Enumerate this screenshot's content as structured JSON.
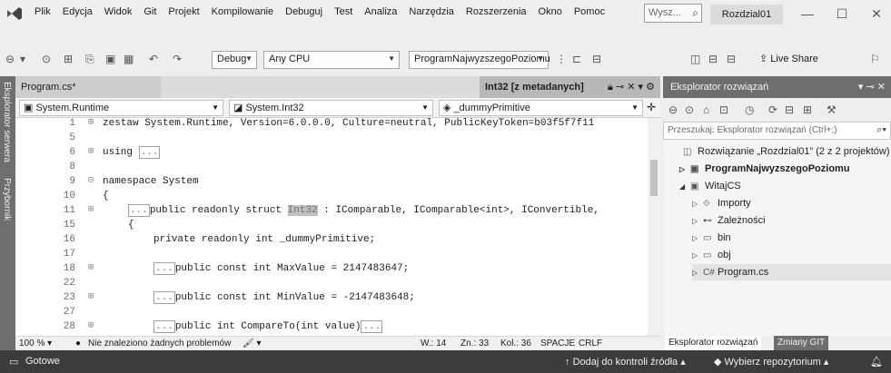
{
  "menu": {
    "items": [
      "Plik",
      "Edycja",
      "Widok",
      "Git",
      "Projekt",
      "Kompilowanie",
      "Debuguj",
      "Test",
      "Analiza",
      "Narzędzia",
      "Rozszerzenia",
      "Okno",
      "Pomoc"
    ],
    "search_label": "Wysz...",
    "project_name": "Rozdzial01"
  },
  "toolbar": {
    "config": "Debug",
    "platform": "Any CPU",
    "startup_project": "ProgramNajwyzszegoPoziomu",
    "live_share": "Live Share"
  },
  "side_tabs": [
    "Eksplorator serwera",
    "Przybornik"
  ],
  "editor": {
    "tabs": [
      "Program.cs*",
      "Int32 [z metadanych]"
    ],
    "nav": {
      "assembly": "System.Runtime",
      "type": "System.Int32",
      "member": "_dummyPrimitive"
    },
    "lines": [
      {
        "num": "1",
        "fold": "⊞",
        "text": "zestaw System.Runtime, Version=6.0.0.0, Culture=neutral, PublicKeyToken=b03f5f7f11"
      },
      {
        "num": "5",
        "fold": "",
        "text": ""
      },
      {
        "num": "6",
        "fold": "⊞",
        "text": "using ",
        "collapsed": "..."
      },
      {
        "num": "8",
        "fold": "",
        "text": ""
      },
      {
        "num": "9",
        "fold": "⊟",
        "text": "namespace System"
      },
      {
        "num": "10",
        "fold": "",
        "text": "{"
      },
      {
        "num": "11",
        "fold": "⊞",
        "collapsed": "...",
        "text": "public readonly struct ",
        "highlight": "Int32",
        "text_after": " : IComparable, IComparable<int>, IConvertible,"
      },
      {
        "num": "15",
        "fold": "",
        "text": "{"
      },
      {
        "num": "16",
        "fold": "",
        "text": "private readonly int _dummyPrimitive;"
      },
      {
        "num": "17",
        "fold": "",
        "text": ""
      },
      {
        "num": "18",
        "fold": "⊞",
        "collapsed": "...",
        "text": "public const int MaxValue = 2147483647;"
      },
      {
        "num": "22",
        "fold": "",
        "text": ""
      },
      {
        "num": "23",
        "fold": "⊞",
        "collapsed": "...",
        "text": "public const int MinValue = -2147483648;"
      },
      {
        "num": "27",
        "fold": "",
        "text": ""
      },
      {
        "num": "28",
        "fold": "⊞",
        "collapsed": "...",
        "text": "public int CompareTo(int value)",
        "collapsed_after": "..."
      }
    ],
    "status": {
      "zoom": "100 %",
      "problems": "Nie znaleziono żadnych problemów",
      "line": "W.: 14",
      "char": "Zn.: 33",
      "col": "Kol.: 36",
      "spaces": "SPACJE",
      "eol": "CRLF"
    }
  },
  "solution_explorer": {
    "title": "Eksplorator rozwiązań",
    "search_placeholder": "Przeszukaj: Eksplorator rozwiązań (Ctrl+;)",
    "tree": [
      {
        "label": "Rozwiązanie „Rozdzial01” (2 z 2 projektów)",
        "icon": "solution-icon",
        "glyph": "◫",
        "indent": 0,
        "exp": "",
        "bold": false
      },
      {
        "label": "ProgramNajwyzszegoPoziomu",
        "icon": "csharp-project-icon",
        "glyph": "▣",
        "indent": 1,
        "exp": "▷",
        "bold": true
      },
      {
        "label": "WitajCS",
        "icon": "csharp-project-icon",
        "glyph": "▣",
        "indent": 1,
        "exp": "◢",
        "bold": false
      },
      {
        "label": "Importy",
        "icon": "imports-icon",
        "glyph": "⟐",
        "indent": 2,
        "exp": "▷",
        "bold": false
      },
      {
        "label": "Zależności",
        "icon": "dependencies-icon",
        "glyph": "⊷",
        "indent": 2,
        "exp": "▷",
        "bold": false
      },
      {
        "label": "bin",
        "icon": "folder-icon",
        "glyph": "▭",
        "indent": 2,
        "exp": "▷",
        "bold": false
      },
      {
        "label": "obj",
        "icon": "folder-icon",
        "glyph": "▭",
        "indent": 2,
        "exp": "▷",
        "bold": false
      },
      {
        "label": "Program.cs",
        "icon": "csharp-file-icon",
        "glyph": "C#",
        "indent": 2,
        "exp": "▷",
        "bold": false,
        "selected": true
      }
    ],
    "bottom_tabs": [
      "Eksplorator rozwiązań",
      "Zmiany GIT"
    ]
  },
  "statusbar": {
    "ready": "Gotowe",
    "add_source": "Dodaj do kontroli źródła",
    "select_repo": "Wybierz repozytorium"
  }
}
